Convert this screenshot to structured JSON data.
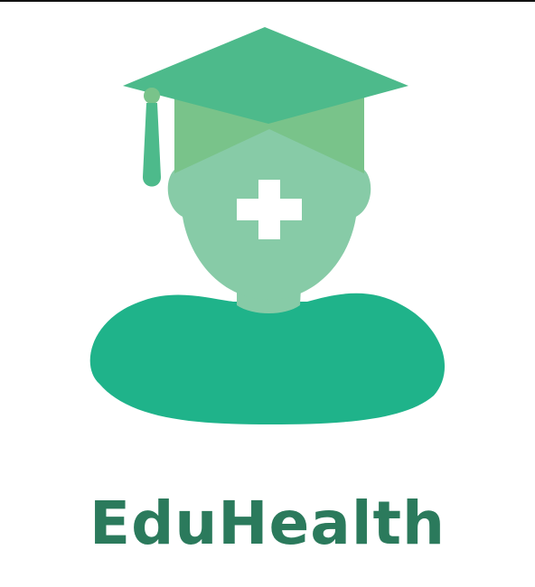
{
  "brand": {
    "name": "EduHealth"
  },
  "logo": {
    "icon": "graduate-with-medical-cross-icon",
    "colors": {
      "cap": "#4dba8b",
      "cap_band": "#79c38a",
      "head": "#87cba7",
      "body": "#1fb38a",
      "cross": "#ffffff",
      "text": "#2b7a5c"
    }
  }
}
